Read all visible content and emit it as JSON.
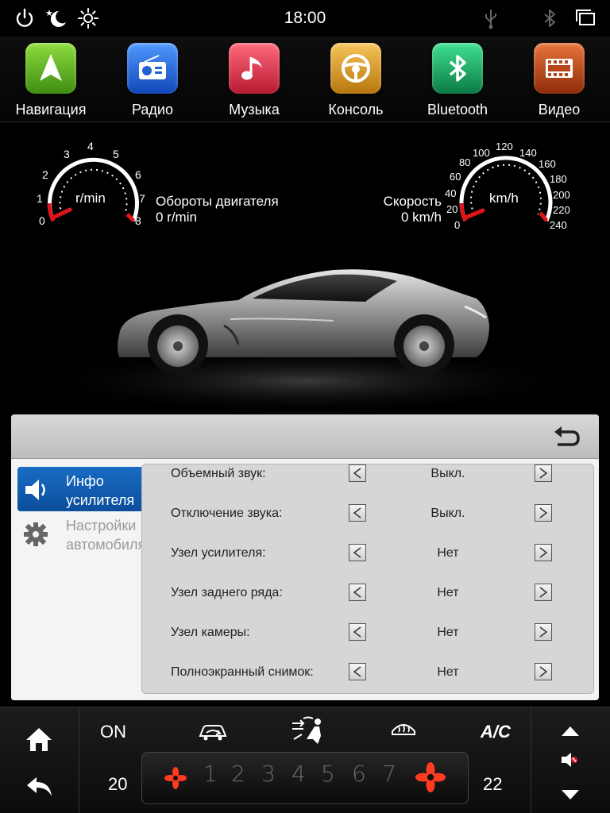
{
  "status_bar": {
    "time": "18:00",
    "left_icons": [
      "power-icon",
      "night-mode-icon",
      "brightness-icon"
    ],
    "right_icons": [
      "usb-icon",
      "bluetooth-icon",
      "recent-apps-icon"
    ]
  },
  "apps": [
    {
      "label": "Навигация",
      "icon": "navigation-icon",
      "color": "#5aa51e"
    },
    {
      "label": "Радио",
      "icon": "radio-icon",
      "color": "#1e63d4"
    },
    {
      "label": "Музыка",
      "icon": "music-icon",
      "color": "#d8334a"
    },
    {
      "label": "Консоль",
      "icon": "steering-wheel-icon",
      "color": "#d99a20"
    },
    {
      "label": "Bluetooth",
      "icon": "bluetooth-icon",
      "color": "#1aa060"
    },
    {
      "label": "Видео",
      "icon": "video-icon",
      "color": "#b6471a"
    }
  ],
  "gauges": {
    "rpm": {
      "unit": "r/min",
      "ticks": [
        "0",
        "1",
        "2",
        "3",
        "4",
        "5",
        "6",
        "7",
        "8"
      ],
      "title": "Обороты двигателя",
      "value_text": "0 r/min",
      "value": 0
    },
    "speed": {
      "unit": "km/h",
      "ticks": [
        "0",
        "20",
        "40",
        "60",
        "80",
        "100",
        "120",
        "140",
        "160",
        "180",
        "200",
        "220",
        "240"
      ],
      "title": "Скорость",
      "value_text": "0 km/h",
      "value": 0
    }
  },
  "panel": {
    "back_icon": "back-arrow-icon",
    "sidebar": [
      {
        "label": "Инфо усилителя",
        "icon": "speaker-icon",
        "active": true
      },
      {
        "label": "Настройки автомобиля",
        "icon": "gear-icon",
        "active": false
      }
    ],
    "rows": [
      {
        "label": "Объемный звук:",
        "value": "Выкл."
      },
      {
        "label": "Отключение звука:",
        "value": "Выкл."
      },
      {
        "label": "Узел усилителя:",
        "value": "Нет"
      },
      {
        "label": "Узел заднего ряда:",
        "value": "Нет"
      },
      {
        "label": "Узел камеры:",
        "value": "Нет"
      },
      {
        "label": "Полноэкранный снимок:",
        "value": "Нет"
      }
    ]
  },
  "climate": {
    "power_label": "ON",
    "ac_label": "A/C",
    "left_temp": "20",
    "right_temp": "22",
    "fan_levels": [
      "1",
      "2",
      "3",
      "4",
      "5",
      "6",
      "7"
    ],
    "icons": [
      "air-recirculation-icon",
      "airflow-mode-icon",
      "defrost-icon",
      "fan-icon"
    ]
  },
  "side_controls": {
    "left": [
      "home-icon",
      "back-icon"
    ],
    "right": [
      "volume-up-icon",
      "mute-icon",
      "volume-down-icon"
    ]
  },
  "colors": {
    "accent_blue": "#1a6cc4",
    "gauge_red": "#e0151b",
    "fan_red": "#ff3b20"
  }
}
